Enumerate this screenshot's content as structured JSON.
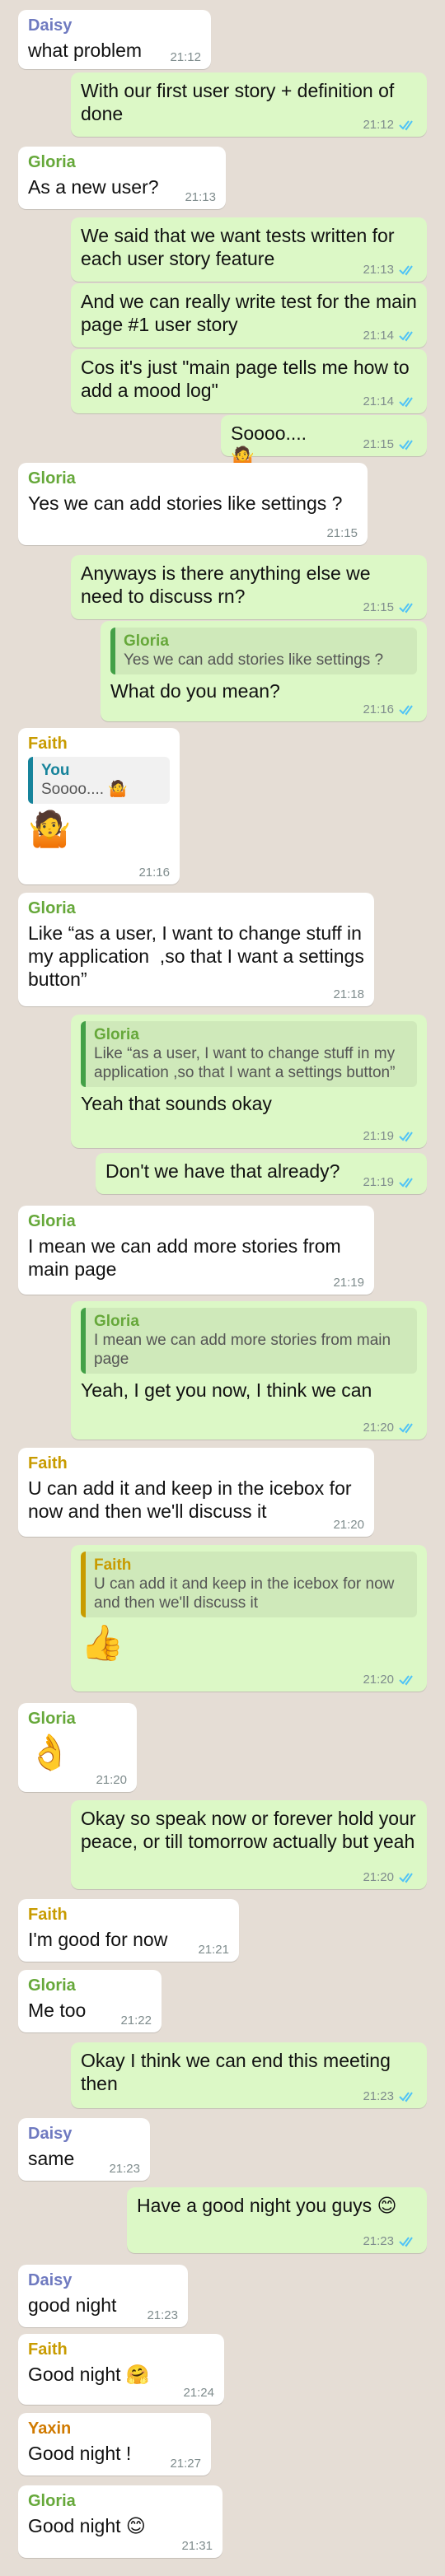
{
  "colors": {
    "incoming_bg": "#ffffff",
    "outgoing_bg": "#dcf8c6",
    "daisy": "#6f7ac0",
    "gloria": "#66a83a",
    "faith": "#c89b00",
    "yaxin": "#d07a00",
    "you": "#16839b",
    "time": "#7f8c8d",
    "read_ticks": "#4fc3f7"
  },
  "messages": [
    {
      "id": 1,
      "sender": "Daisy",
      "text": "what problem",
      "time": "21:12"
    },
    {
      "id": 2,
      "text": "With our first user story + definition of done",
      "time": "21:12"
    },
    {
      "id": 3,
      "sender": "Gloria",
      "text": "As a new user?",
      "time": "21:13"
    },
    {
      "id": 4,
      "text": "We said that we want tests written for each user story feature",
      "time": "21:13"
    },
    {
      "id": 5,
      "text": "And we can really write test for the main page #1 user story",
      "time": "21:14"
    },
    {
      "id": 6,
      "text": "Cos it's just \"main page tells me how to add a mood log\"",
      "time": "21:14"
    },
    {
      "id": 7,
      "text": "Soooo.... 🤷",
      "time": "21:15"
    },
    {
      "id": 8,
      "sender": "Gloria",
      "text": "Yes we can add stories like settings ?",
      "time": "21:15"
    },
    {
      "id": 9,
      "text": "Anyways is there anything else we need to discuss rn?",
      "time": "21:15"
    },
    {
      "id": 10,
      "quote_name": "Gloria",
      "quote_text": "Yes we can add stories like settings ?",
      "text": "What do you mean?",
      "time": "21:16"
    },
    {
      "id": 11,
      "sender": "Faith",
      "quote_name": "You",
      "quote_text": "Soooo.... 🤷",
      "text": "🤷",
      "time": "21:16"
    },
    {
      "id": 12,
      "sender": "Gloria",
      "text": "Like “as a user, I want to change stuff in my application  ,so that I want a settings button”",
      "time": "21:18"
    },
    {
      "id": 13,
      "quote_name": "Gloria",
      "quote_text": "Like “as a user, I want to change stuff in my application  ,so that I want a settings button”",
      "text": "Yeah that sounds okay",
      "time": "21:19"
    },
    {
      "id": 14,
      "text": "Don't we have that already?",
      "time": "21:19"
    },
    {
      "id": 15,
      "sender": "Gloria",
      "text": "I mean we can add more stories from main page",
      "time": "21:19"
    },
    {
      "id": 16,
      "quote_name": "Gloria",
      "quote_text": "I mean we can add more stories from main page",
      "text": "Yeah, I get you now, I think we can",
      "time": "21:20"
    },
    {
      "id": 17,
      "sender": "Faith",
      "text": "U can add it and keep in the icebox for now and then we'll discuss it",
      "time": "21:20"
    },
    {
      "id": 18,
      "quote_name": "Faith",
      "quote_text": "U can add it and keep in the icebox for now and then we'll discuss it",
      "text": "👍",
      "time": "21:20"
    },
    {
      "id": 19,
      "sender": "Gloria",
      "text": "👌",
      "time": "21:20"
    },
    {
      "id": 20,
      "text": "Okay so speak now or forever hold your peace, or till tomorrow actually but yeah",
      "time": "21:20"
    },
    {
      "id": 21,
      "sender": "Faith",
      "text": "I'm good for now",
      "time": "21:21"
    },
    {
      "id": 22,
      "sender": "Gloria",
      "text": "Me too",
      "time": "21:22"
    },
    {
      "id": 23,
      "text": "Okay I think we can end this meeting then",
      "time": "21:23"
    },
    {
      "id": 24,
      "sender": "Daisy",
      "text": "same",
      "time": "21:23"
    },
    {
      "id": 25,
      "text": "Have a good night you guys 😊",
      "time": "21:23"
    },
    {
      "id": 26,
      "sender": "Daisy",
      "text": "good night",
      "time": "21:23"
    },
    {
      "id": 27,
      "sender": "Faith",
      "text": "Good night 🤗",
      "time": "21:24"
    },
    {
      "id": 28,
      "sender": "Yaxin",
      "text": "Good night !",
      "time": "21:27"
    },
    {
      "id": 29,
      "sender": "Gloria",
      "text": "Good night 😊",
      "time": "21:31"
    }
  ]
}
